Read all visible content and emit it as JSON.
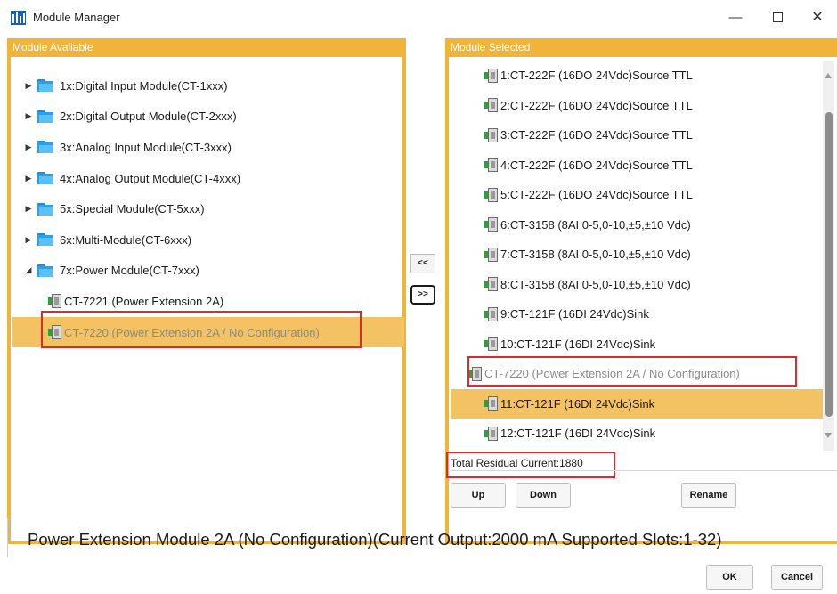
{
  "window": {
    "title": "Module Manager",
    "minimize_glyph": "—",
    "close_glyph": "✕"
  },
  "left_panel": {
    "header": "Module Avaliable",
    "categories": [
      {
        "label": "1x:Digital Input Module(CT-1xxx)",
        "expanded": false
      },
      {
        "label": "2x:Digital Output Module(CT-2xxx)",
        "expanded": false
      },
      {
        "label": "3x:Analog Input Module(CT-3xxx)",
        "expanded": false
      },
      {
        "label": "4x:Analog Output Module(CT-4xxx)",
        "expanded": false
      },
      {
        "label": "5x:Special Module(CT-5xxx)",
        "expanded": false
      },
      {
        "label": "6x:Multi-Module(CT-6xxx)",
        "expanded": false
      },
      {
        "label": "7x:Power Module(CT-7xxx)",
        "expanded": true
      }
    ],
    "children": [
      {
        "label": "CT-7221 (Power Extension 2A)",
        "selected": false
      },
      {
        "label": "CT-7220 (Power Extension 2A / No Configuration)",
        "selected": true
      }
    ],
    "collapsed_glyph": "▶",
    "expanded_glyph": "◢"
  },
  "transfer": {
    "remove_label": "<<",
    "add_label": ">>"
  },
  "right_panel": {
    "header": "Module Selected",
    "items": [
      {
        "label": "1:CT-222F (16DO 24Vdc)Source TTL",
        "selected": false,
        "muted": false
      },
      {
        "label": "2:CT-222F (16DO 24Vdc)Source TTL",
        "selected": false,
        "muted": false
      },
      {
        "label": "3:CT-222F (16DO 24Vdc)Source TTL",
        "selected": false,
        "muted": false
      },
      {
        "label": "4:CT-222F (16DO 24Vdc)Source TTL",
        "selected": false,
        "muted": false
      },
      {
        "label": "5:CT-222F (16DO 24Vdc)Source TTL",
        "selected": false,
        "muted": false
      },
      {
        "label": "6:CT-3158 (8AI 0-5,0-10,±5,±10 Vdc)",
        "selected": false,
        "muted": false
      },
      {
        "label": "7:CT-3158 (8AI 0-5,0-10,±5,±10 Vdc)",
        "selected": false,
        "muted": false
      },
      {
        "label": "8:CT-3158 (8AI 0-5,0-10,±5,±10 Vdc)",
        "selected": false,
        "muted": false
      },
      {
        "label": "9:CT-121F (16DI 24Vdc)Sink",
        "selected": false,
        "muted": false
      },
      {
        "label": "10:CT-121F (16DI 24Vdc)Sink",
        "selected": false,
        "muted": false
      },
      {
        "label": "CT-7220 (Power Extension 2A / No Configuration)",
        "selected": false,
        "muted": true
      },
      {
        "label": "11:CT-121F (16DI 24Vdc)Sink",
        "selected": true,
        "muted": false
      },
      {
        "label": "12:CT-121F (16DI 24Vdc)Sink",
        "selected": false,
        "muted": false
      }
    ],
    "status": "Total Residual Current:1880",
    "buttons": {
      "up": "Up",
      "down": "Down",
      "rename": "Rename"
    }
  },
  "description": "Power Extension Module 2A (No Configuration)(Current Output:2000 mA  Supported Slots:1-32)",
  "footer": {
    "ok": "OK",
    "cancel": "Cancel"
  },
  "colors": {
    "accent": "#f0b43a",
    "selection": "#f2c263",
    "highlight": "#e02a2a",
    "folder": "#2aa0ec"
  }
}
